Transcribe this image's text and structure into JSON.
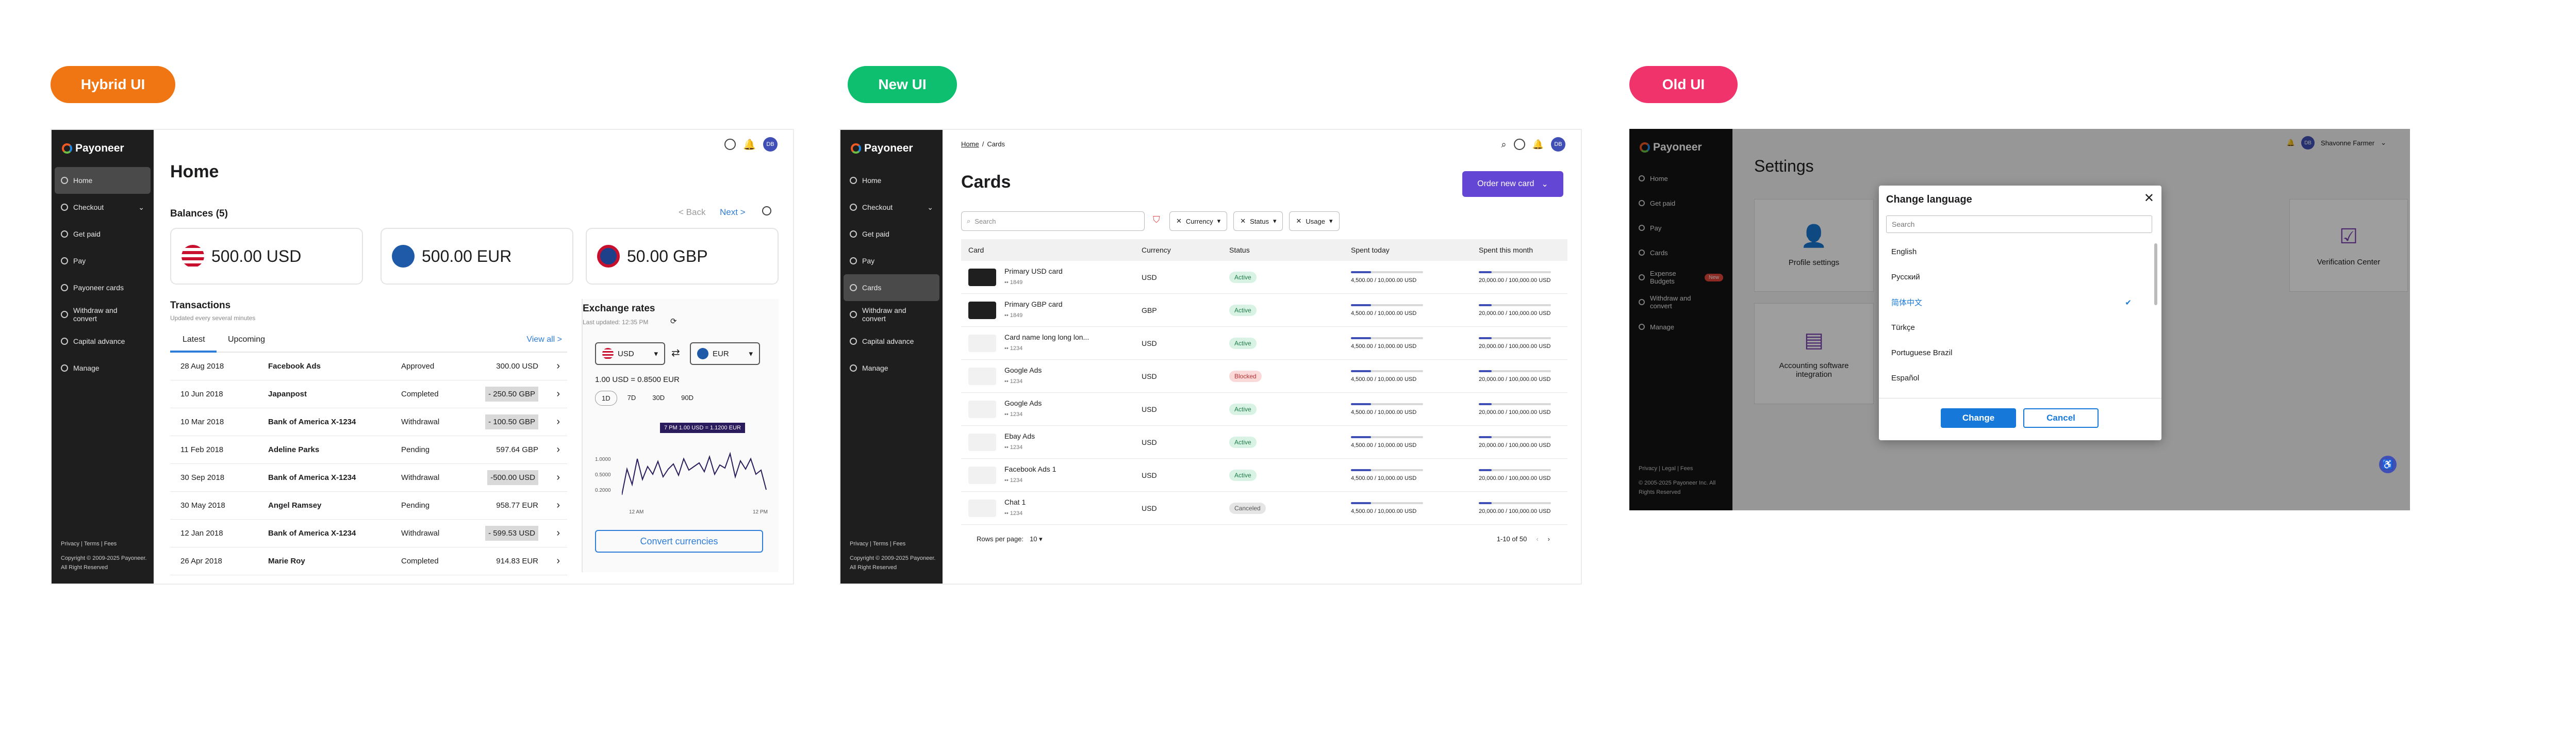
{
  "labels": {
    "hybrid": "Hybrid UI",
    "new": "New UI",
    "old": "Old UI"
  },
  "colors": {
    "hybrid": "#f07613",
    "new": "#0dbf6f",
    "old": "#f0346b",
    "accent": "#2e7dd8",
    "purple": "#6347d4",
    "sidebar": "#1e1e1e"
  },
  "brand": "Payoneer",
  "avatar": "DB",
  "footer": {
    "links": "Privacy | Terms | Fees",
    "copyright": "Copyright © 2009-2025 Payoneer. All Right Reserved"
  },
  "hybrid": {
    "nav": [
      "Home",
      "Checkout",
      "Get paid",
      "Pay",
      "Payoneer cards",
      "Withdraw and convert",
      "Capital advance",
      "Manage"
    ],
    "title": "Home",
    "balances_title": "Balances (5)",
    "back": "< Back",
    "next": "Next >",
    "balances": [
      {
        "amount": "500.00 USD"
      },
      {
        "amount": "500.00 EUR"
      },
      {
        "amount": "50.00 GBP"
      }
    ],
    "transactions_title": "Transactions",
    "transactions_sub": "Updated every several minutes",
    "tabs": [
      "Latest",
      "Upcoming"
    ],
    "view_all": "View all >",
    "rows": [
      {
        "date": "28 Aug 2018",
        "name": "Facebook Ads",
        "status": "Approved",
        "amount": "300.00 USD"
      },
      {
        "date": "10 Jun 2018",
        "name": "Japanpost",
        "status": "Completed",
        "amount": "- 250.50 GBP"
      },
      {
        "date": "10 Mar 2018",
        "name": "Bank of America X-1234",
        "status": "Withdrawal",
        "amount": "- 100.50 GBP"
      },
      {
        "date": "11 Feb 2018",
        "name": "Adeline Parks",
        "status": "Pending",
        "amount": "597.64 GBP"
      },
      {
        "date": "30 Sep 2018",
        "name": "Bank of America X-1234",
        "status": "Withdrawal",
        "amount": "-500.00 USD"
      },
      {
        "date": "30 May 2018",
        "name": "Angel Ramsey",
        "status": "Pending",
        "amount": "958.77 EUR"
      },
      {
        "date": "12 Jan 2018",
        "name": "Bank of America X-1234",
        "status": "Withdrawal",
        "amount": "- 599.53 USD"
      },
      {
        "date": "26 Apr 2018",
        "name": "Marie Roy",
        "status": "Completed",
        "amount": "914.83 EUR"
      }
    ],
    "exchange": {
      "title": "Exchange rates",
      "updated": "Last updated: 12:35 PM",
      "from": "USD",
      "to": "EUR",
      "rate": "1.00 USD = 0.8500 EUR",
      "periods": [
        "1D",
        "7D",
        "30D",
        "90D"
      ],
      "tooltip": "7 PM 1.00 USD = 1.1200 EUR",
      "yticks": [
        "1.0000",
        "0.5000",
        "0.2000"
      ],
      "xticks": [
        "12 AM",
        "12 PM"
      ],
      "convert": "Convert currencies"
    }
  },
  "newui": {
    "nav": [
      "Home",
      "Checkout",
      "Get paid",
      "Pay",
      "Cards",
      "Withdraw and convert",
      "Capital advance",
      "Manage"
    ],
    "breadcrumb": [
      "Home",
      "Cards"
    ],
    "title": "Cards",
    "order": "Order new card",
    "search_placeholder": "Search",
    "filters": [
      "Currency",
      "Status",
      "Usage"
    ],
    "columns": [
      "Card",
      "Currency",
      "Status",
      "Spent today",
      "Spent this month"
    ],
    "rows": [
      {
        "name": "Primary USD card",
        "num": "•• 1849",
        "currency": "USD",
        "status": "Active",
        "today": "4,500.00 / 10,000.00 USD",
        "month": "20,000.00 / 100,000.00 USD"
      },
      {
        "name": "Primary GBP card",
        "num": "•• 1849",
        "currency": "GBP",
        "status": "Active",
        "today": "4,500.00 / 10,000.00 USD",
        "month": "20,000.00 / 100,000.00 USD"
      },
      {
        "name": "Card name long long lon...",
        "num": "•• 1234",
        "currency": "USD",
        "status": "Active",
        "today": "4,500.00 / 10,000.00 USD",
        "month": "20,000.00 / 100,000.00 USD"
      },
      {
        "name": "Google Ads",
        "num": "•• 1234",
        "currency": "USD",
        "status": "Blocked",
        "today": "4,500.00 / 10,000.00 USD",
        "month": "20,000.00 / 100,000.00 USD"
      },
      {
        "name": "Google Ads",
        "num": "•• 1234",
        "currency": "USD",
        "status": "Active",
        "today": "4,500.00 / 10,000.00 USD",
        "month": "20,000.00 / 100,000.00 USD"
      },
      {
        "name": "Ebay Ads",
        "num": "•• 1234",
        "currency": "USD",
        "status": "Active",
        "today": "4,500.00 / 10,000.00 USD",
        "month": "20,000.00 / 100,000.00 USD"
      },
      {
        "name": "Facebook Ads 1",
        "num": "•• 1234",
        "currency": "USD",
        "status": "Active",
        "today": "4,500.00 / 10,000.00 USD",
        "month": "20,000.00 / 100,000.00 USD"
      },
      {
        "name": "Chat 1",
        "num": "•• 1234",
        "currency": "USD",
        "status": "Canceled",
        "today": "4,500.00 / 10,000.00 USD",
        "month": "20,000.00 / 100,000.00 USD"
      }
    ],
    "rows_per_page_label": "Rows per page:",
    "rows_per_page": "10",
    "pagination": "1-10 of 50"
  },
  "oldui": {
    "nav": [
      "Home",
      "Get paid",
      "Pay",
      "Cards",
      "Expense Budgets",
      "Withdraw and convert",
      "Manage"
    ],
    "new_badge": "New",
    "user": "Shavonne Farmer",
    "title": "Settings",
    "tiles": [
      "Profile settings",
      "Verification Center",
      "Accounting software integration"
    ],
    "footer_links": "Privacy | Legal | Fees",
    "footer_copy": "© 2005-2025 Payoneer Inc. All Rights Reserved",
    "dialog": {
      "title": "Change language",
      "search_placeholder": "Search",
      "languages": [
        "English",
        "Русский",
        "简体中文",
        "Türkçe",
        "Portuguese Brazil",
        "Español"
      ],
      "selected": "简体中文",
      "change": "Change",
      "cancel": "Cancel"
    }
  }
}
